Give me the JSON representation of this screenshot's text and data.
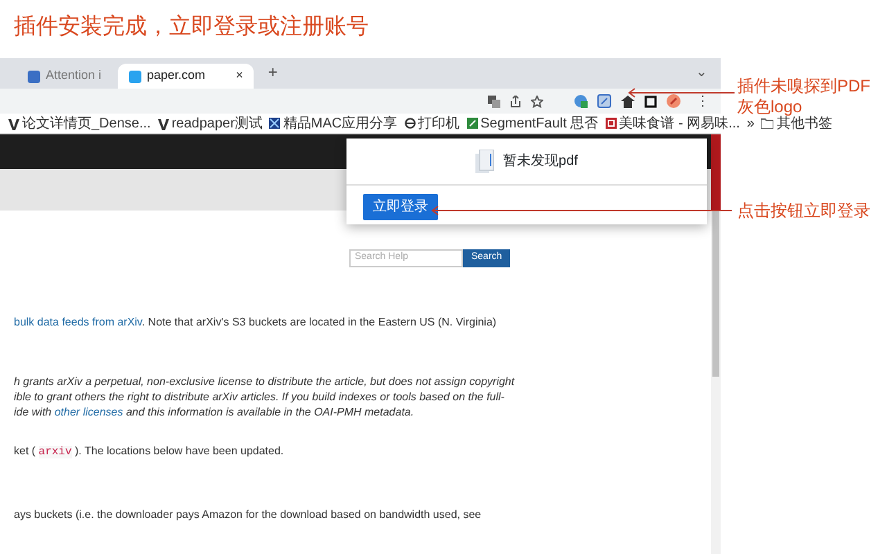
{
  "heading": "插件安装完成，立即登录或注册账号",
  "tabs": [
    {
      "label": "Attention i",
      "selected": false
    },
    {
      "label": "paper.com",
      "selected": true
    }
  ],
  "tab_close": "×",
  "new_tab": "+",
  "tab_menu": "⌄",
  "toolbar_menu": "⋮",
  "bookmarks": [
    {
      "label": "论文详情页_Dense...",
      "kind": "v"
    },
    {
      "label": "readpaper测试",
      "kind": "v"
    },
    {
      "label": "精品MAC应用分享",
      "kind": "square"
    },
    {
      "label": "打印机",
      "kind": "globe"
    },
    {
      "label": "SegmentFault 思否",
      "kind": "sf"
    },
    {
      "label": "美味食谱 - 网易味...",
      "kind": "red"
    }
  ],
  "bookmarks_more": "»",
  "other_bookmarks": "其他书签",
  "popup": {
    "message": "暂未发现pdf",
    "button": "立即登录"
  },
  "search": {
    "placeholder": "Search Help",
    "button": "Search"
  },
  "paragraphs": [
    {
      "italic": false,
      "lines": [
        [
          {
            "kind": "link",
            "text": "bulk data feeds from arXiv"
          },
          {
            "kind": "text",
            "text": ". Note that arXiv's S3 buckets are located in the Eastern US (N. Virginia)"
          }
        ]
      ]
    },
    {
      "italic": true,
      "lines": [
        [
          {
            "kind": "text",
            "text": "h grants arXiv a perpetual, non-exclusive license to distribute the article, but does not assign copyright"
          }
        ],
        [
          {
            "kind": "text",
            "text": "ible to grant others the right to distribute arXiv articles. If you build indexes or tools based on the full-"
          }
        ],
        [
          {
            "kind": "text",
            "text": "ide with "
          },
          {
            "kind": "link",
            "text": "other licenses"
          },
          {
            "kind": "text",
            "text": " and this information is available in the OAI-PMH metadata."
          }
        ]
      ]
    },
    {
      "italic": false,
      "lines": [
        [
          {
            "kind": "text",
            "text": "ket ( "
          },
          {
            "kind": "code",
            "text": "arxiv"
          },
          {
            "kind": "text",
            "text": " ). The locations below have been updated."
          }
        ]
      ]
    },
    {
      "italic": false,
      "lines": [
        [
          {
            "kind": "text",
            "text": "ays buckets (i.e. the downloader pays Amazon for the download based on bandwidth used, see"
          }
        ]
      ]
    }
  ],
  "annotations": [
    {
      "lines": [
        "插件未嗅探到PDF",
        "灰色logo"
      ]
    },
    {
      "lines": [
        "点击按钮立即登录"
      ]
    }
  ]
}
